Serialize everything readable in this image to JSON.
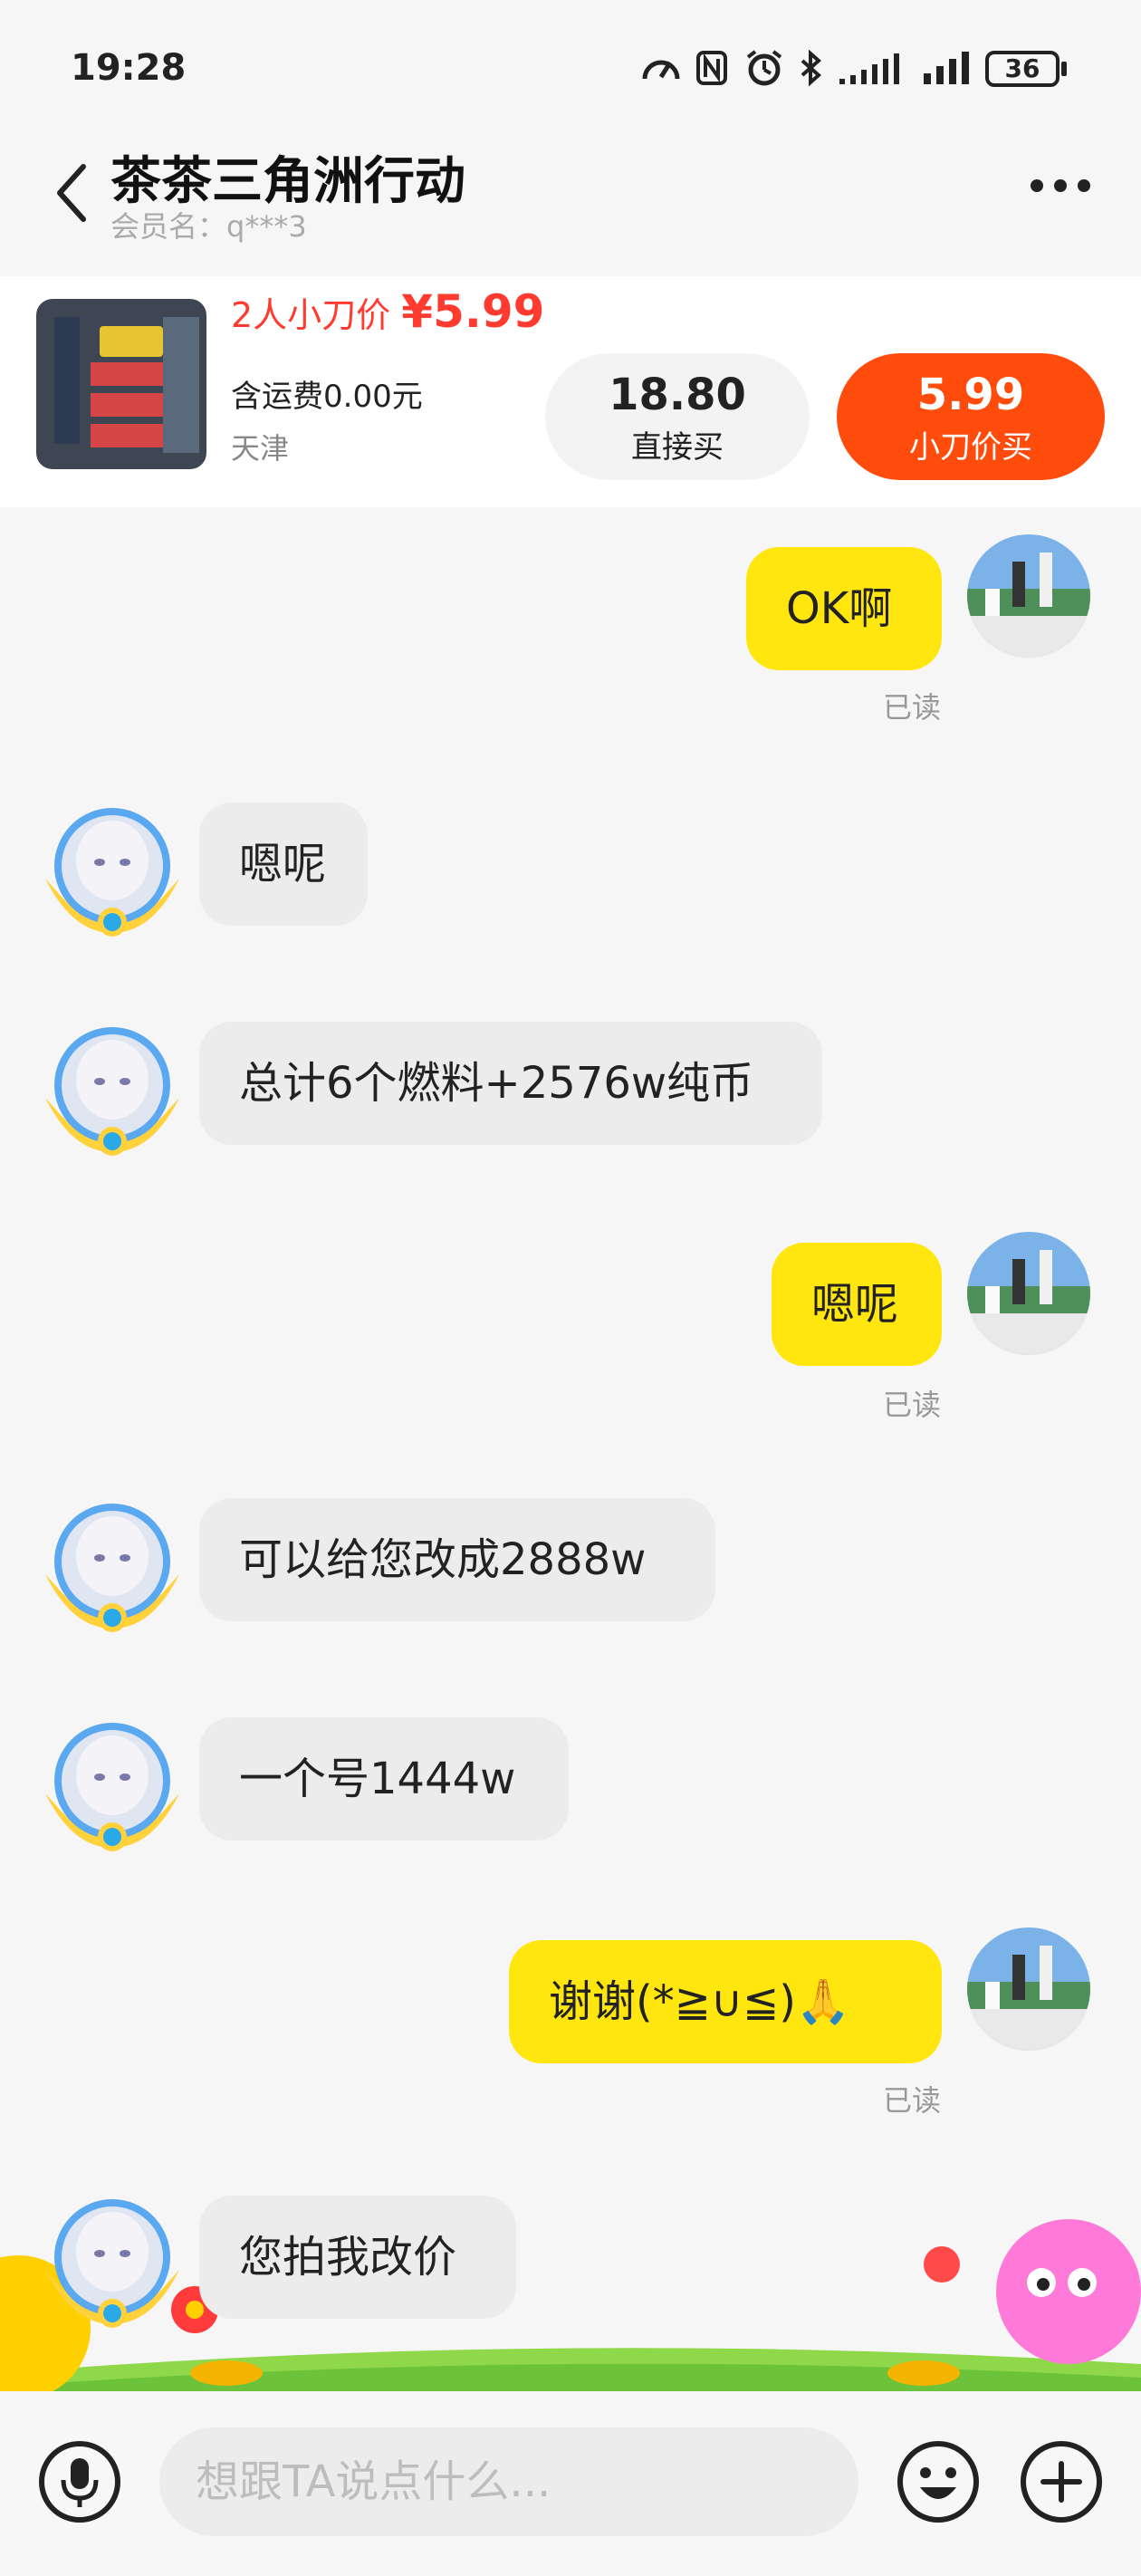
{
  "status_bar": {
    "time": "19:28",
    "battery": "36",
    "icons": [
      "speedometer-icon",
      "nfc-icon",
      "alarm-icon",
      "bluetooth-icon",
      "signal-icon",
      "signal-icon",
      "battery-icon"
    ]
  },
  "header": {
    "title": "茶茶三角洲行动",
    "member_label": "会员名：q***3",
    "back_icon": "chevron-left-icon",
    "more_icon": "more-dots-icon"
  },
  "product": {
    "promo_label": "2人小刀价",
    "promo_price": "¥5.99",
    "shipping": "含运费0.00元",
    "location": "天津",
    "direct_buy_price": "18.80",
    "direct_buy_label": "直接买",
    "bargain_price": "5.99",
    "bargain_label": "小刀价买"
  },
  "messages": [
    {
      "from": "me",
      "text": "OK啊",
      "status": "已读"
    },
    {
      "from": "them",
      "text": "嗯呢"
    },
    {
      "from": "them",
      "text": "总计6个燃料+2576w纯币"
    },
    {
      "from": "me",
      "text": "嗯呢",
      "status": "已读"
    },
    {
      "from": "them",
      "text": "可以给您改成2888w"
    },
    {
      "from": "them",
      "text": "一个号1444w"
    },
    {
      "from": "me",
      "text": "谢谢(*≧∪≦)🙏",
      "status": "已读"
    },
    {
      "from": "them",
      "text": "您拍我改价"
    }
  ],
  "input": {
    "placeholder": "想跟TA说点什么...",
    "mic_icon": "microphone-icon",
    "emoji_icon": "emoji-icon",
    "plus_icon": "plus-icon"
  },
  "colors": {
    "my_bubble": "#ffe60f",
    "their_bubble": "#ececec",
    "accent_red": "#ff3b30",
    "bargain_button": "#ff4c0c"
  }
}
